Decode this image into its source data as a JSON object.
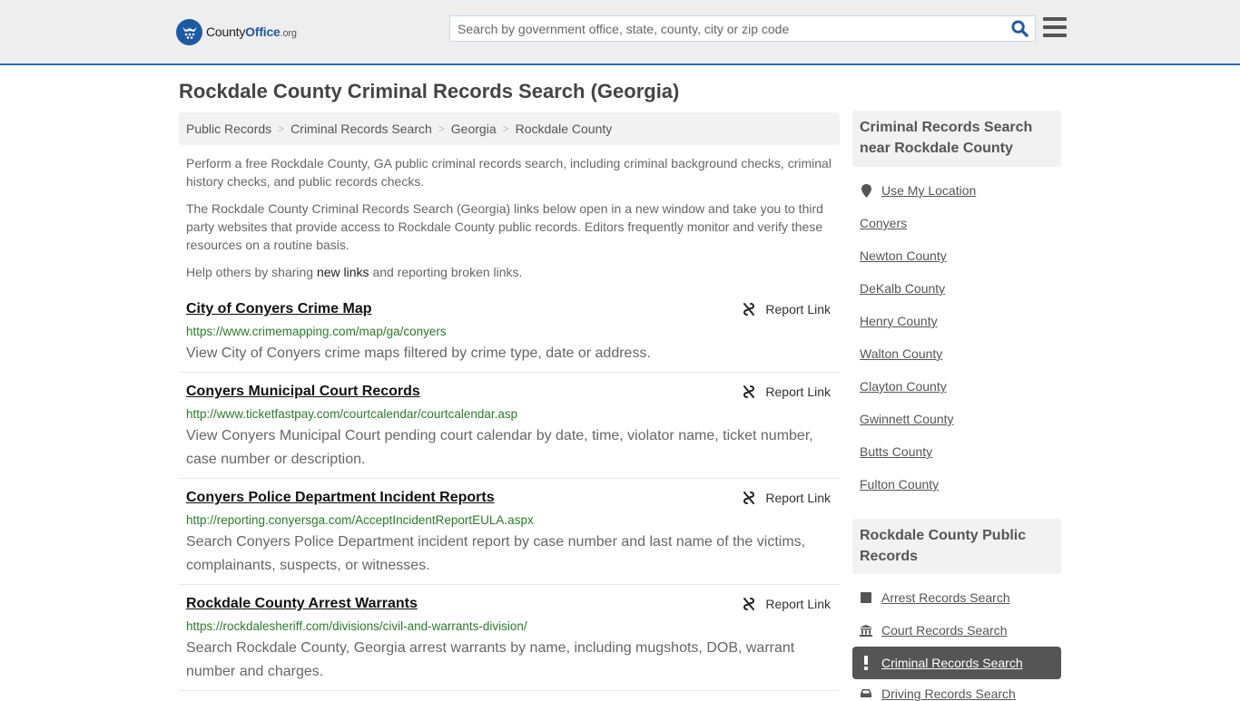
{
  "header": {
    "logo": {
      "name_part1": "County",
      "name_part2": "Office",
      "tld": ".org"
    },
    "search": {
      "placeholder": "Search by government office, state, county, city or zip code",
      "value": ""
    },
    "accent_color": "#1d5aa3",
    "border_color": "#2e6fb4"
  },
  "page": {
    "title": "Rockdale County Criminal Records Search (Georgia)",
    "breadcrumb": [
      "Public Records",
      "Criminal Records Search",
      "Georgia",
      "Rockdale County"
    ],
    "intro": {
      "p1": "Perform a free Rockdale County, GA public criminal records search, including criminal background checks, criminal history checks, and public records checks.",
      "p2": "The Rockdale County Criminal Records Search (Georgia) links below open in a new window and take you to third party websites that provide access to Rockdale County public records. Editors frequently monitor and verify these resources on a routine basis.",
      "p3_before": "Help others by sharing ",
      "p3_link": "new links",
      "p3_after": " and reporting broken links."
    },
    "report_label": "Report Link",
    "listings": [
      {
        "title": "City of Conyers Crime Map",
        "url": "https://www.crimemapping.com/map/ga/conyers",
        "description": "View City of Conyers crime maps filtered by crime type, date or address."
      },
      {
        "title": "Conyers Municipal Court Records",
        "url": "http://www.ticketfastpay.com/courtcalendar/courtcalendar.asp",
        "description": "View Conyers Municipal Court pending court calendar by date, time, violator name, ticket number, case number or description."
      },
      {
        "title": "Conyers Police Department Incident Reports",
        "url": "http://reporting.conyersga.com/AcceptIncidentReportEULA.aspx",
        "description": "Search Conyers Police Department incident report by case number and last name of the victims, complainants, suspects, or witnesses."
      },
      {
        "title": "Rockdale County Arrest Warrants",
        "url": "https://rockdalesheriff.com/divisions/civil-and-warrants-division/",
        "description": "Search Rockdale County, Georgia arrest warrants by name, including mugshots, DOB, warrant number and charges."
      }
    ]
  },
  "sidebar": {
    "nearby": {
      "heading": "Criminal Records Search near Rockdale County",
      "use_location": "Use My Location",
      "items": [
        "Conyers",
        "Newton County",
        "DeKalb County",
        "Henry County",
        "Walton County",
        "Clayton County",
        "Gwinnett County",
        "Butts County",
        "Fulton County"
      ]
    },
    "public_records": {
      "heading": "Rockdale County Public Records",
      "items": [
        {
          "label": "Arrest Records Search",
          "icon": "square-icon",
          "active": false
        },
        {
          "label": "Court Records Search",
          "icon": "courthouse-icon",
          "active": false
        },
        {
          "label": "Criminal Records Search",
          "icon": "exclamation-icon",
          "active": true
        },
        {
          "label": "Driving Records Search",
          "icon": "car-icon",
          "active": false
        }
      ]
    }
  }
}
